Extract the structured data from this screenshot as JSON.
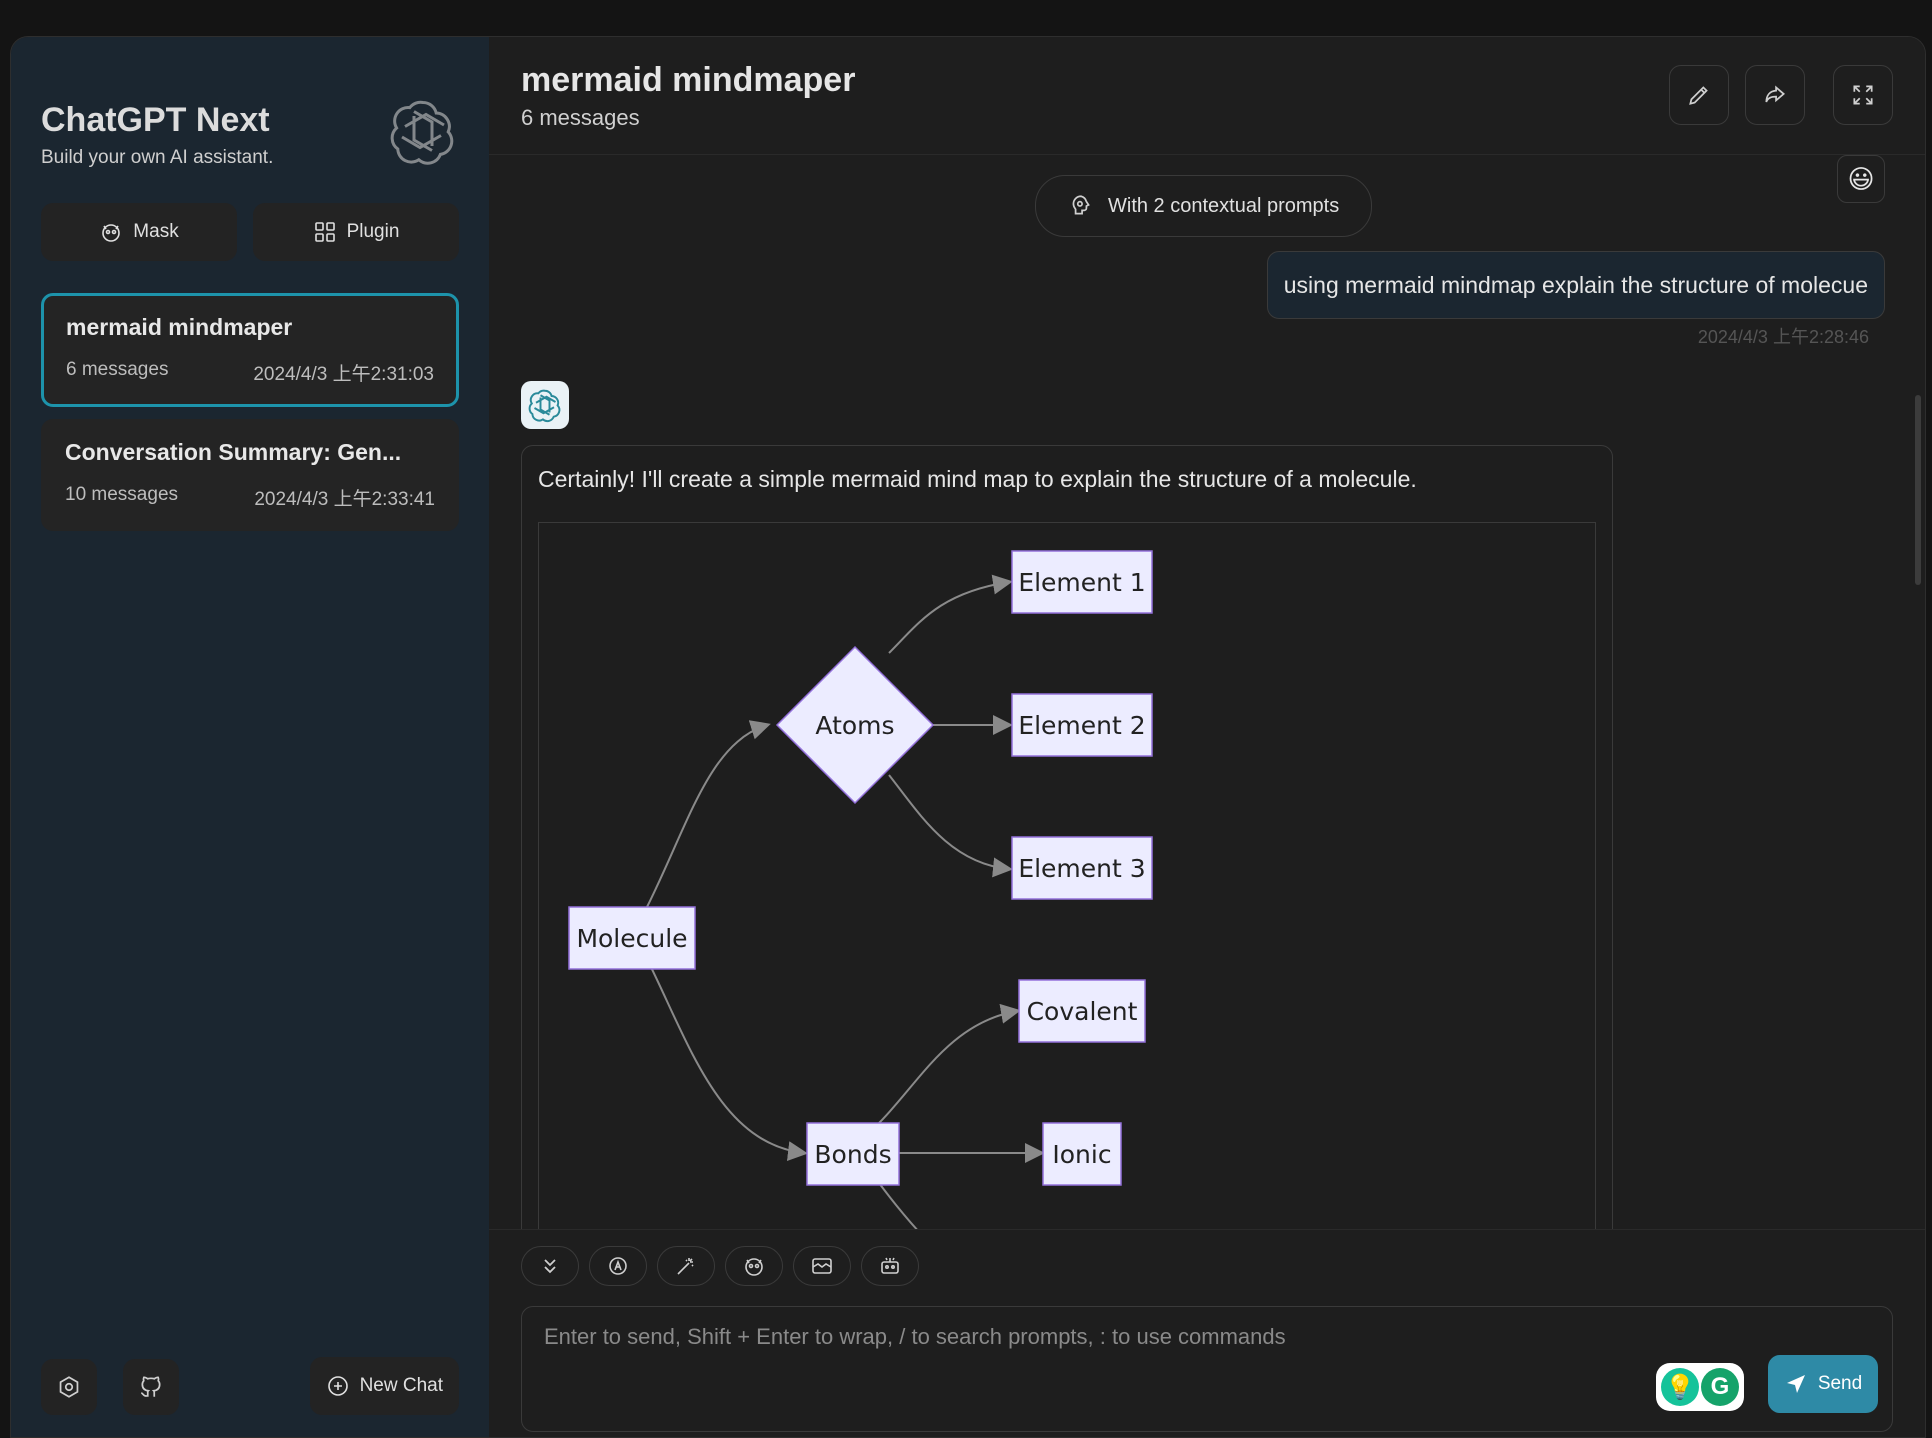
{
  "sidebar": {
    "title": "ChatGPT Next",
    "subtitle": "Build your own AI assistant.",
    "mask_label": "Mask",
    "plugin_label": "Plugin",
    "sessions": [
      {
        "title": "mermaid mindmaper",
        "count": "6 messages",
        "date": "2024/4/3 上午2:31:03"
      },
      {
        "title": "Conversation Summary: Gen...",
        "count": "10 messages",
        "date": "2024/4/3 上午2:33:41"
      }
    ],
    "new_chat_label": "New Chat"
  },
  "header": {
    "title": "mermaid mindmaper",
    "subtitle": "6 messages"
  },
  "messages": {
    "context_label": "With 2 contextual prompts",
    "user_avatar": "😃",
    "user_text": "using mermaid mindmap explain the structure of molecue",
    "user_date": "2024/4/3 上午2:28:46",
    "bot_text": "Certainly! I'll create a simple mermaid mind map to explain the structure of a molecule."
  },
  "diagram": {
    "nodes": {
      "molecule": "Molecule",
      "atoms": "Atoms",
      "bonds": "Bonds",
      "el1": "Element 1",
      "el2": "Element 2",
      "el3": "Element 3",
      "covalent": "Covalent",
      "ionic": "Ionic"
    }
  },
  "input": {
    "placeholder": "Enter to send, Shift + Enter to wrap, / to search prompts, : to use commands",
    "send_label": "Send"
  },
  "colors": {
    "accent": "#1d93ab",
    "send": "#2e8aa6",
    "node_fill": "#ececff",
    "node_stroke": "#9370db"
  }
}
